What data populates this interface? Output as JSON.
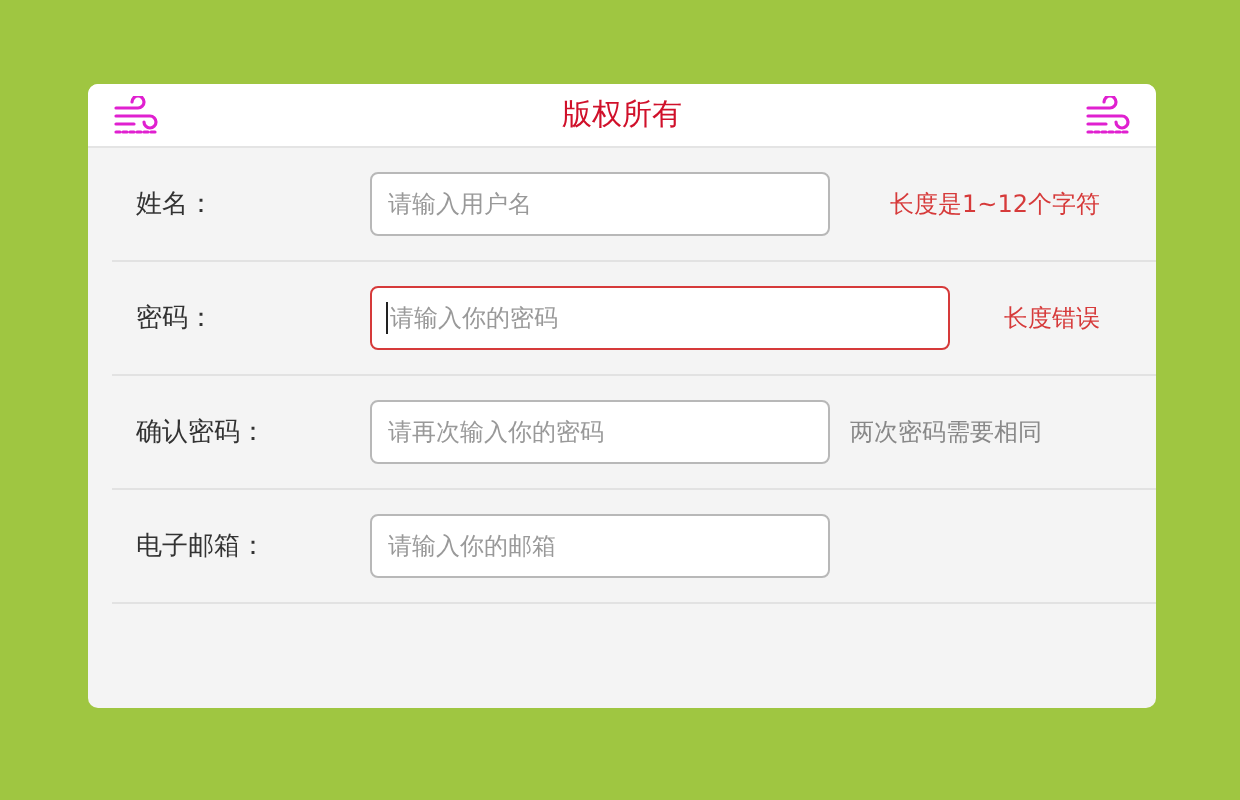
{
  "header": {
    "title": "版权所有"
  },
  "fields": [
    {
      "label": "姓名：",
      "placeholder": "请输入用户名",
      "invalid": false,
      "focused": false,
      "hint": {
        "text": "长度是1~12个字符",
        "kind": "error"
      }
    },
    {
      "label": "密码：",
      "placeholder": "请输入你的密码",
      "invalid": true,
      "focused": true,
      "hint": {
        "text": "长度错误",
        "kind": "error"
      }
    },
    {
      "label": "确认密码：",
      "placeholder": "请再次输入你的密码",
      "invalid": false,
      "focused": false,
      "hint": {
        "text": "两次密码需要相同",
        "kind": "info"
      }
    },
    {
      "label": "电子邮箱：",
      "placeholder": "请输入你的邮箱",
      "invalid": false,
      "focused": false
    }
  ]
}
